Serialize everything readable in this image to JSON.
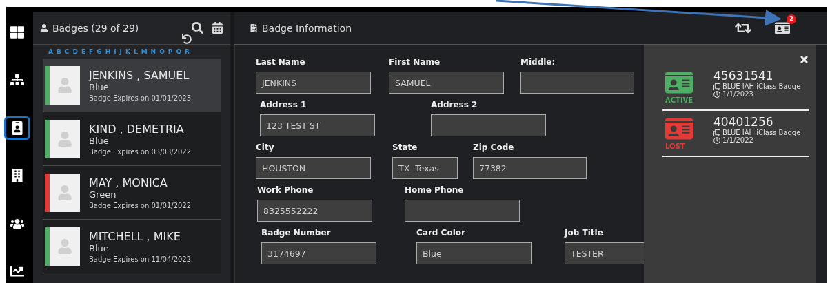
{
  "rail": [
    {
      "selected": false
    },
    {
      "selected": false
    },
    {
      "selected": true
    },
    {
      "selected": false
    },
    {
      "selected": false
    },
    {
      "selected": false
    }
  ],
  "badges_panel": {
    "title": "Badges (29 of 29)",
    "letters": [
      "A",
      "B",
      "C",
      "D",
      "E",
      "F",
      "G",
      "H",
      "I",
      "J",
      "K",
      "L",
      "M",
      "N",
      "O",
      "P",
      "Q",
      "R"
    ],
    "items": [
      {
        "name": "JENKINS , SAMUEL",
        "card_color": "Blue",
        "expires": "Badge Expires on 01/01/2023",
        "color": "#4caf63",
        "selected": true
      },
      {
        "name": "KIND , DEMETRIA",
        "card_color": "Blue",
        "expires": "Badge Expires on 03/03/2022",
        "color": "#4caf63",
        "selected": false
      },
      {
        "name": "MAY , MONICA",
        "card_color": "Green",
        "expires": "Badge Expires on 01/01/2022",
        "color": "#e53935",
        "selected": false
      },
      {
        "name": "MITCHELL , MIKE",
        "card_color": "Blue",
        "expires": "Badge Expires on 11/04/2022",
        "color": "#4caf63",
        "selected": false
      }
    ]
  },
  "detail": {
    "title": "Badge Information",
    "notification_count": "2",
    "form_rows": [
      [
        {
          "label": "Last Name",
          "value": "JENKINS"
        },
        {
          "label": "First Name",
          "value": "SAMUEL"
        },
        {
          "label": "Middle:"
        }
      ],
      [
        {
          "label": "Address 1",
          "value": "123 TEST ST"
        },
        {
          "label": "Address 2"
        }
      ],
      [
        {
          "label": "City",
          "value": "HOUSTON"
        },
        {
          "label": "State",
          "value": "TX  Texas"
        },
        {
          "label": "Zip Code",
          "value": "77382"
        }
      ],
      [
        {
          "label": "Work Phone",
          "value": "8325552222"
        },
        {
          "label": "Home Phone"
        }
      ],
      [
        {
          "label": "Badge Number",
          "value": "3174697"
        },
        {
          "label": "Card Color",
          "value": "Blue"
        },
        {
          "label": "Job Title",
          "value": "TESTER"
        }
      ]
    ]
  },
  "badge_history": [
    {
      "number": "45631541",
      "status": "ACTIVE",
      "color": "#4caf63",
      "type": "BLUE IAH iClass Badge",
      "date": "1/1/2023"
    },
    {
      "number": "40401256",
      "status": "LOST",
      "color": "#e53935",
      "type": "BLUE IAH iClass Badge",
      "date": "1/1/2022"
    }
  ]
}
